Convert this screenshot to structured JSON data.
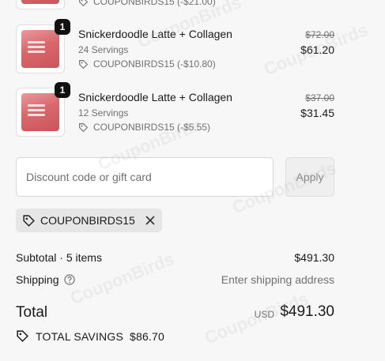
{
  "watermark": "CouponBirds",
  "items": [
    {
      "name": "",
      "servings": "",
      "code_line": "COUPONBIRDS15 (-$21.00)",
      "qty": "",
      "original_price": "",
      "price": ""
    },
    {
      "name": "Snickerdoodle Latte + Collagen",
      "servings": "24 Servings",
      "code_line": "COUPONBIRDS15 (-$10.80)",
      "qty": "1",
      "original_price": "$72.00",
      "price": "$61.20"
    },
    {
      "name": "Snickerdoodle Latte + Collagen",
      "servings": "12 Servings",
      "code_line": "COUPONBIRDS15 (-$5.55)",
      "qty": "1",
      "original_price": "$37.00",
      "price": "$31.45"
    }
  ],
  "discount": {
    "placeholder": "Discount code or gift card",
    "apply_label": "Apply",
    "applied_code": "COUPONBIRDS15"
  },
  "summary": {
    "subtotal_label": "Subtotal · 5 items",
    "subtotal_value": "$491.30",
    "shipping_label": "Shipping",
    "shipping_value": "Enter shipping address",
    "total_label": "Total",
    "total_currency": "USD",
    "total_value": "$491.30",
    "savings_label": "TOTAL SAVINGS",
    "savings_value": "$86.70"
  },
  "colors": {
    "background": "#f7f7f7",
    "text": "#1a1a1a",
    "muted": "#707070",
    "badge": "#111111"
  },
  "icons": [
    "tag-icon",
    "close-icon",
    "help-icon",
    "savings-tag-icon"
  ]
}
